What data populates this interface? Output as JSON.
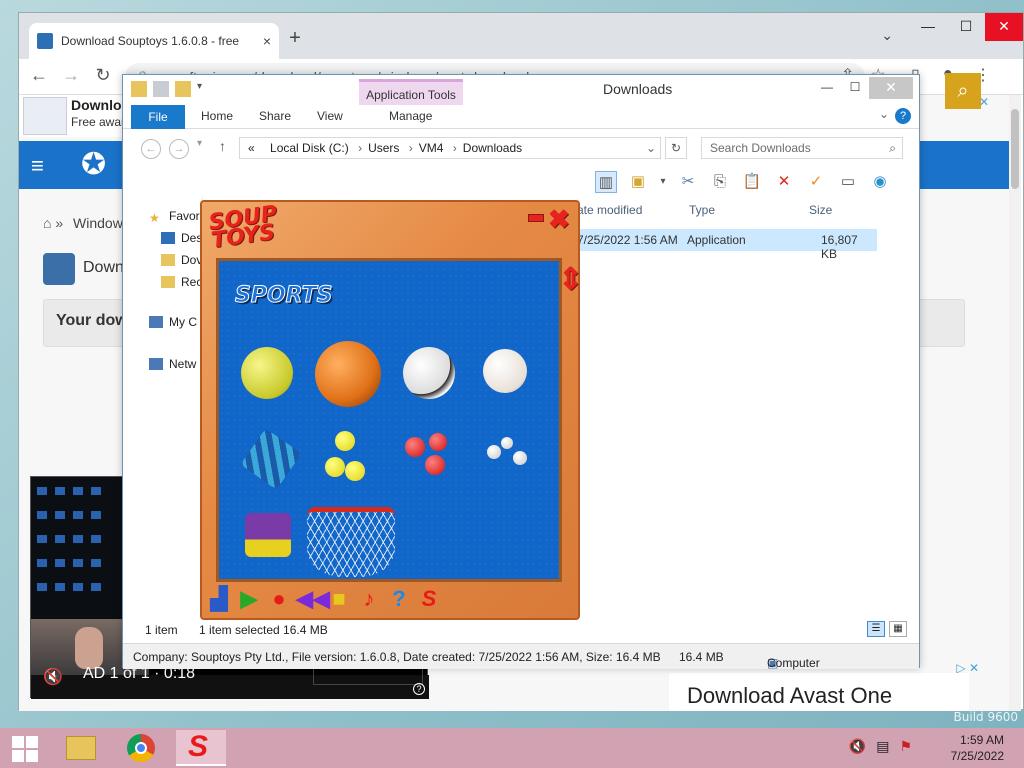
{
  "desktop": {
    "build_text": "Build 9600"
  },
  "chrome": {
    "tab_title": "Download Souptoys 1.6.0.8 - free",
    "tab_close": "×",
    "new_tab": "+",
    "url": "en.softonic.com/download/souptoys/windows/post-download"
  },
  "page": {
    "ad_top_title": "Downlo",
    "ad_top_sub": "Free awar",
    "breadcrumb": "Window",
    "product_title": "Down",
    "your_download": "Your dow",
    "bottom_ad": "Download Avast One",
    "ad_x": "▷ ✕"
  },
  "video_ad": {
    "label": "AD 1 of 1 · 0:18"
  },
  "explorer": {
    "title": "Downloads",
    "app_tools": "Application Tools",
    "tabs": {
      "file": "File",
      "home": "Home",
      "share": "Share",
      "view": "View",
      "manage": "Manage"
    },
    "address": [
      "Local Disk (C:)",
      "Users",
      "VM4",
      "Downloads"
    ],
    "address_prefix": "«",
    "search_placeholder": "Search Downloads",
    "nav": [
      "Favor",
      "Des",
      "Dov",
      "Rec",
      "My C",
      "Netw"
    ],
    "columns": {
      "date": "ate modified",
      "type": "Type",
      "size": "Size"
    },
    "row": {
      "date": "7/25/2022 1:56 AM",
      "type": "Application",
      "size": "16,807 KB"
    },
    "status": {
      "count": "1 item",
      "selected": "1 item selected  16.4 MB"
    },
    "details": {
      "info": "Company: Souptoys Pty Ltd., File version: 1.6.0.8, Date created: 7/25/2022 1:56 AM, Size: 16.4 MB",
      "size": "16.4 MB",
      "location": "Computer"
    }
  },
  "souptoys": {
    "logo_line1": "SOUP",
    "logo_line2": "TOYS",
    "category": "SPORTS"
  },
  "taskbar": {
    "time": "1:59 AM",
    "date": "7/25/2022"
  },
  "colors": {
    "taskbar": "#d1a2b1",
    "file_tab": "#1979ca",
    "souptoys_panel": "#1166c9",
    "softonic_blue": "#1a73c9"
  }
}
